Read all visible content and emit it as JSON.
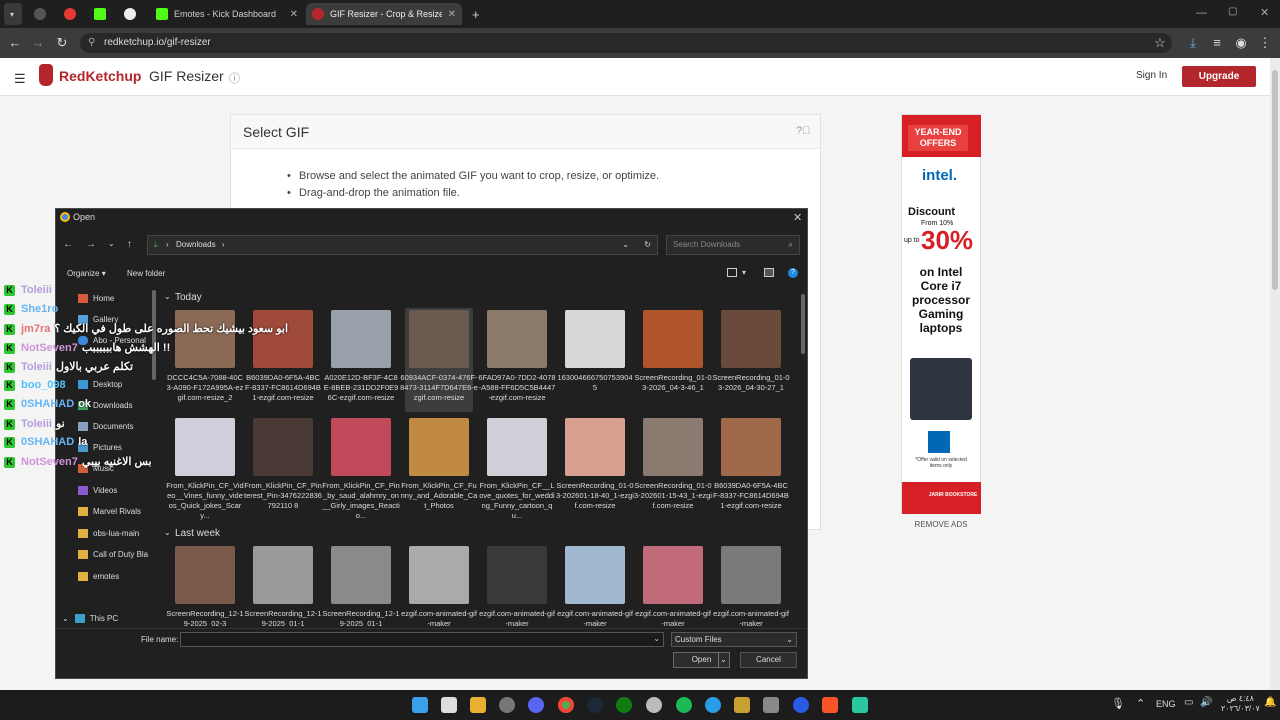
{
  "browser": {
    "tabs": [
      {
        "label": "",
        "active": false,
        "color": "#1f1f1f"
      },
      {
        "label": "",
        "active": false,
        "color": "#e53935"
      },
      {
        "label": "",
        "active": false,
        "color": "#53fc18"
      },
      {
        "label": "",
        "active": false,
        "color": "#eeeeee"
      },
      {
        "label": "Emotes - Kick Dashboard",
        "active": false,
        "color": "#53fc18"
      },
      {
        "label": "GIF Resizer - Crop & Resize Anim",
        "active": true,
        "color": "#b3262c"
      }
    ],
    "new_tab": "+",
    "address": "redketchup.io/gif-resizer"
  },
  "site": {
    "brand": "RedKetchup",
    "page_title": "GIF Resizer",
    "sign_in": "Sign In",
    "upgrade": "Upgrade",
    "card_title": "Select GIF",
    "bullets": [
      "Browse and select the animated GIF you want to crop, resize, or optimize.",
      "Drag-and-drop the animation file."
    ]
  },
  "ad": {
    "badge": "YEAR-END OFFERS",
    "brand": "intel.",
    "discount_label": "Discount",
    "from_label": "From 10%",
    "upto_label": "up to",
    "percent": "30%",
    "line1": "on Intel Core i7 processor Gaming laptops",
    "offer_note": "*Offer valid on selected items only",
    "store": "JARIR BOOKSTORE",
    "remove_ads": "REMOVE ADS"
  },
  "chat": [
    {
      "user": "Toleiii",
      "color": "#b39ddb",
      "message": ""
    },
    {
      "user": "She1ro",
      "color": "#64b5f6",
      "message": ""
    },
    {
      "user": "jm7ra",
      "color": "#e57373",
      "message": "ابو سعود بيشيك تحط الصوره على طول في الكيك ؟"
    },
    {
      "user": "NotSeven7",
      "color": "#ce93d8",
      "message": "الهشش هاببببببب !!"
    },
    {
      "user": "Toleiii",
      "color": "#b39ddb",
      "message": "تكلم عربي بالاول"
    },
    {
      "user": "boo_098",
      "color": "#4fc3f7",
      "message": ""
    },
    {
      "user": "0SHAHAD",
      "color": "#64b5f6",
      "message": "ok"
    },
    {
      "user": "Toleiii",
      "color": "#b39ddb",
      "message": "نو"
    },
    {
      "user": "0SHAHAD",
      "color": "#64b5f6",
      "message": "la"
    },
    {
      "user": "NotSeven7",
      "color": "#ce93d8",
      "message": "بس الاغنيه بيبي"
    }
  ],
  "dialog": {
    "title": "Open",
    "breadcrumb": "Downloads",
    "search_placeholder": "Search Downloads",
    "organize": "Organize",
    "new_folder": "New folder",
    "sidebar": [
      "Home",
      "Gallery",
      "Abo - Personal",
      "Desktop",
      "Downloads",
      "Documents",
      "Pictures",
      "Music",
      "Videos",
      "Marvel Rivals",
      "obs-lua-main",
      "Call of Duty  Bla",
      "emotes",
      "This PC"
    ],
    "groups": [
      "Today",
      "Last week"
    ],
    "files_row1": [
      {
        "name": "DCCC4C5A-7088-40C3-A090-F172A995A-ezgif.com-resize_2",
        "color": "#8a6a55"
      },
      {
        "name": "B6039DA0-6F5A-4BCF-8337-FC8614D694B1-ezgif.com-resize",
        "color": "#a04a3a"
      },
      {
        "name": "A020E12D-BF3F-4C8E-8BEB-231DD2F0E96C-ezgif.com-resize",
        "color": "#9aa0aa"
      },
      {
        "name": "60934ACF-0374-476F-8473-3114F7D647E6-ezgif.com-resize",
        "color": "#6a5a50"
      },
      {
        "name": "6FAD97A0-7DD2-4078-A588-FF6D5C5B4447-ezgif.com-resize",
        "color": "#8b7a6a"
      },
      {
        "name": "1630046667507539045",
        "color": "#d8d8d8"
      },
      {
        "name": "ScreenRecording_01-03-2026_04-3-46_1",
        "color": "#b0552a"
      },
      {
        "name": "ScreenRecording_01-03-2026_04-30-27_1",
        "color": "#6a4a3a"
      }
    ],
    "files_row2": [
      {
        "name": "From_KlickPin_CF_Video__Vines_funny_videos_Quick_jokes_Scary...",
        "color": "#cfcfdc"
      },
      {
        "name": "From_KlickPin_CF_Pinterest_Pin-3476222836792110 8",
        "color": "#4a3a35"
      },
      {
        "name": "From_KlickPin_CF_Pin_by_saud_alahmry_on__Girly_images_Reactio...",
        "color": "#c04a5a"
      },
      {
        "name": "From_KlickPin_CF_Funny_and_Adorable_Cat_Photos",
        "color": "#c08a40"
      },
      {
        "name": "From_KlickPin_CF__Love_quotes_for_wedding_Funny_cartoon_qu...",
        "color": "#d0d0d8"
      },
      {
        "name": "ScreenRecording_01-03-202601-18-40_1-ezgif.com-resize",
        "color": "#d8a090"
      },
      {
        "name": "ScreenRecording_01-03-202601-15-43_1-ezgif.com-resize",
        "color": "#8a7a70"
      },
      {
        "name": "B6039DA0-6F5A-4BCF-8337-FC8614D694B1-ezgif.com-resize",
        "color": "#a06a4a"
      }
    ],
    "files_row3": [
      {
        "name": "ScreenRecording_12-19-2025_02-3",
        "color": "#7a5a4a"
      },
      {
        "name": "ScreenRecording_12-19-2025_01-1",
        "color": "#9a9a9a"
      },
      {
        "name": "ScreenRecording_12-19-2025_01-1",
        "color": "#8a8a8a"
      },
      {
        "name": "ezgif.com-animated-gif-maker",
        "color": "#aaaaaa"
      },
      {
        "name": "ezgif.com-animated-gif-maker",
        "color": "#3a3a3a"
      },
      {
        "name": "ezgif.com-animated-gif-maker",
        "color": "#a0b8d0"
      },
      {
        "name": "ezgif.com-animated-gif-maker",
        "color": "#c06a7a"
      },
      {
        "name": "ezgif.com-animated-gif-maker",
        "color": "#7a7a7a"
      }
    ],
    "file_name_label": "File name:",
    "file_name_value": "",
    "file_type": "Custom Files",
    "open": "Open",
    "cancel": "Cancel"
  },
  "taskbar": {
    "lang": "ENG",
    "time": "٤:٤٨ ص",
    "date": "٢٠٢٦/٠٣/٠٧"
  }
}
